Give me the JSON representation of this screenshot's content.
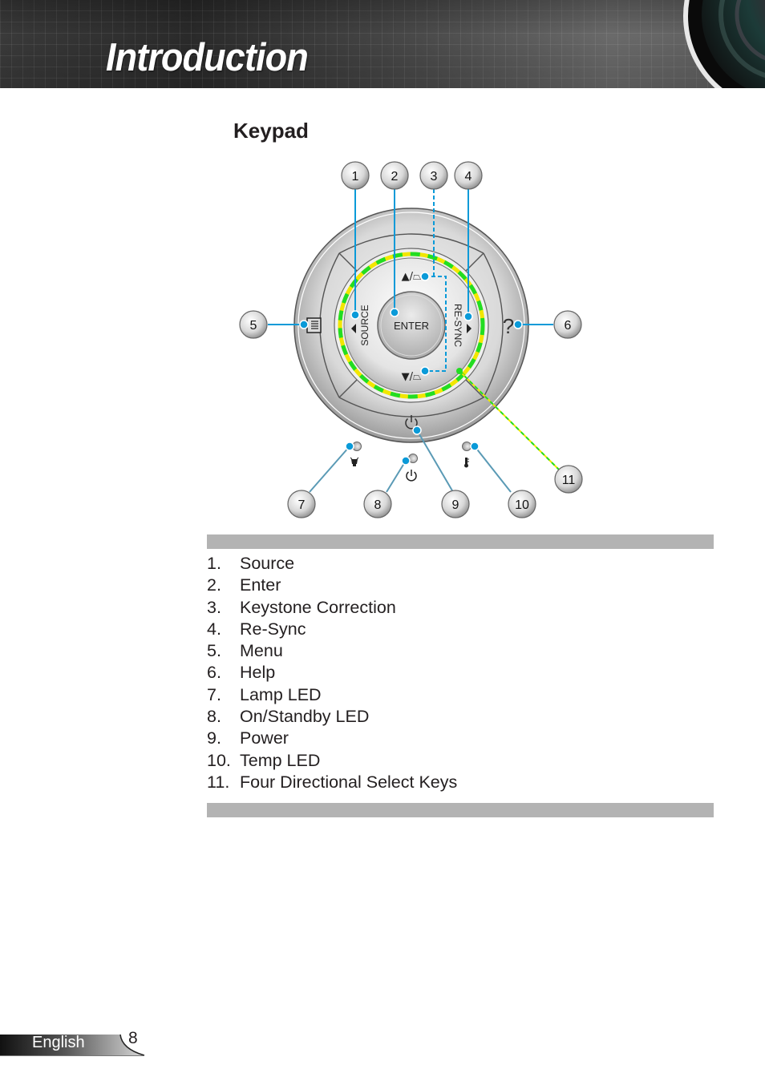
{
  "header": {
    "title": "Introduction"
  },
  "section": {
    "title": "Keypad"
  },
  "diagram": {
    "callouts": [
      "1",
      "2",
      "3",
      "4",
      "5",
      "6",
      "7",
      "8",
      "9",
      "10",
      "11"
    ],
    "labels": {
      "source": "SOURCE",
      "enter": "ENTER",
      "resync": "RE-SYNC",
      "keystone_up": "▲/⏢",
      "keystone_down": "▼/⏢",
      "help": "?"
    },
    "colors": {
      "callout_line": "#0a9ad8",
      "led_line": "#5a9ab5",
      "ring_green": "#22dd22",
      "ring_yellow": "#f2e600"
    }
  },
  "legend": {
    "items": [
      {
        "num": "1.",
        "label": "Source"
      },
      {
        "num": "2.",
        "label": "Enter"
      },
      {
        "num": "3.",
        "label": "Keystone Correction"
      },
      {
        "num": "4.",
        "label": "Re-Sync"
      },
      {
        "num": "5.",
        "label": "Menu"
      },
      {
        "num": "6.",
        "label": "Help"
      },
      {
        "num": "7.",
        "label": "Lamp LED"
      },
      {
        "num": "8.",
        "label": "On/Standby LED"
      },
      {
        "num": "9.",
        "label": "Power"
      },
      {
        "num": "10.",
        "label": "Temp LED"
      },
      {
        "num": "11.",
        "label": "Four Directional Select Keys"
      }
    ]
  },
  "footer": {
    "language": "English",
    "page_number": "8"
  }
}
